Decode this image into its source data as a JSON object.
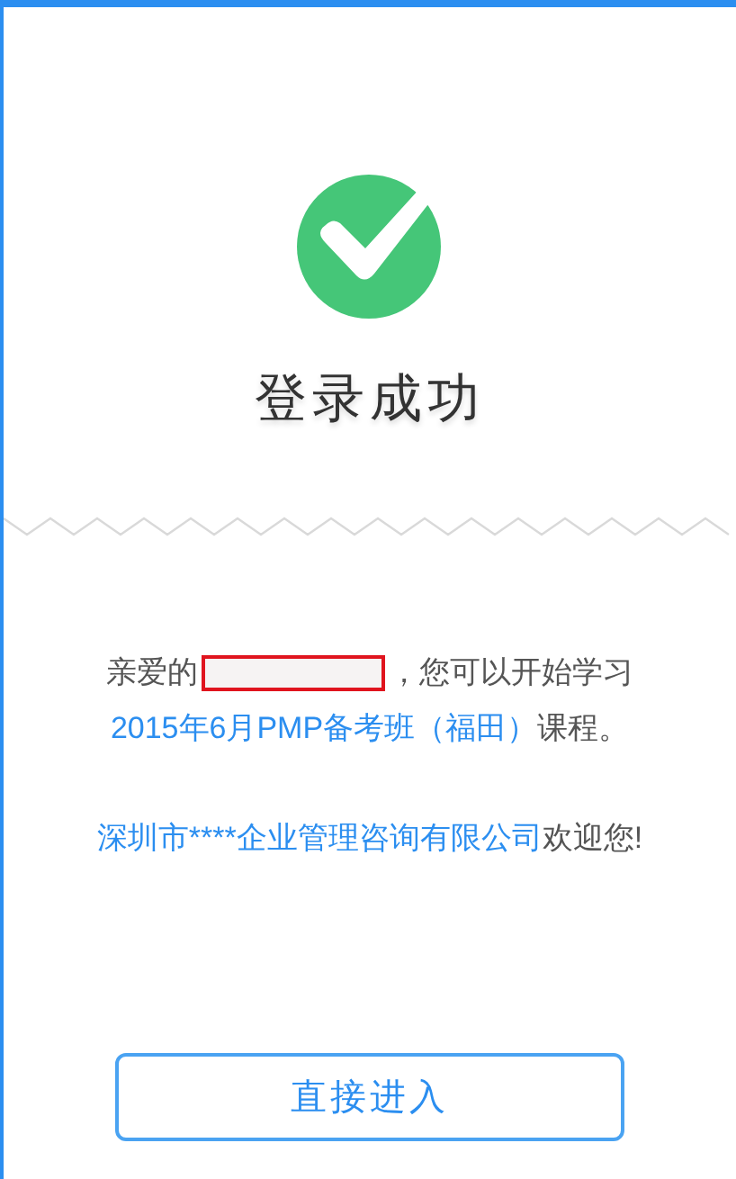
{
  "status": {
    "title": "登录成功"
  },
  "greeting": {
    "prefix": "亲爱的",
    "suffix": "，您可以开始学习",
    "course": "2015年6月PMP备考班（福田）",
    "course_suffix": "课程。"
  },
  "welcome": {
    "company": "深圳市****企业管理咨询有限公司",
    "suffix": "欢迎您!"
  },
  "buttons": [
    "直接进入"
  ]
}
